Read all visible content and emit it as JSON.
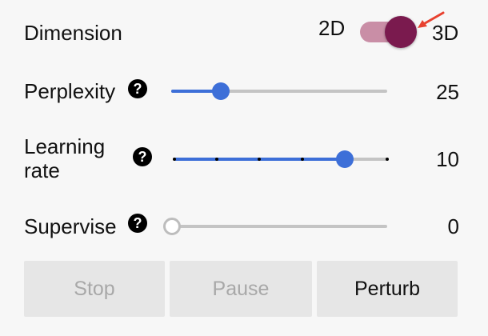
{
  "dimension": {
    "label": "Dimension",
    "option_left": "2D",
    "option_right": "3D",
    "selected": "3D",
    "accent_color": "#7a1a4e"
  },
  "perplexity": {
    "label": "Perplexity",
    "help": "?",
    "value": "25",
    "fraction": 0.23
  },
  "learning_rate": {
    "label_line1": "Learning",
    "label_line2": "rate",
    "help": "?",
    "value": "10",
    "fraction": 0.8,
    "tick_count": 6
  },
  "supervise": {
    "label": "Supervise",
    "help": "?",
    "value": "0",
    "fraction": 0
  },
  "buttons": {
    "stop": "Stop",
    "pause": "Pause",
    "perturb": "Perturb"
  },
  "colors": {
    "slider_blue": "#3d6fd8",
    "annotation_arrow": "#e8412f"
  }
}
